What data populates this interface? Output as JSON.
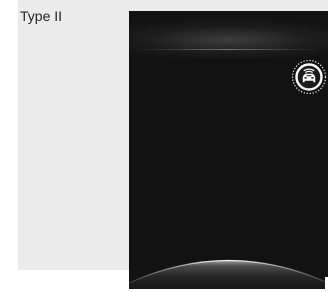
{
  "figure": {
    "label": "Type II"
  },
  "screen": {
    "indicator_icon": "vehicle-front-radar-icon"
  },
  "colors": {
    "panel_background": "#ebebeb",
    "screen_background": "#121212",
    "icon_color": "#ffffff"
  }
}
